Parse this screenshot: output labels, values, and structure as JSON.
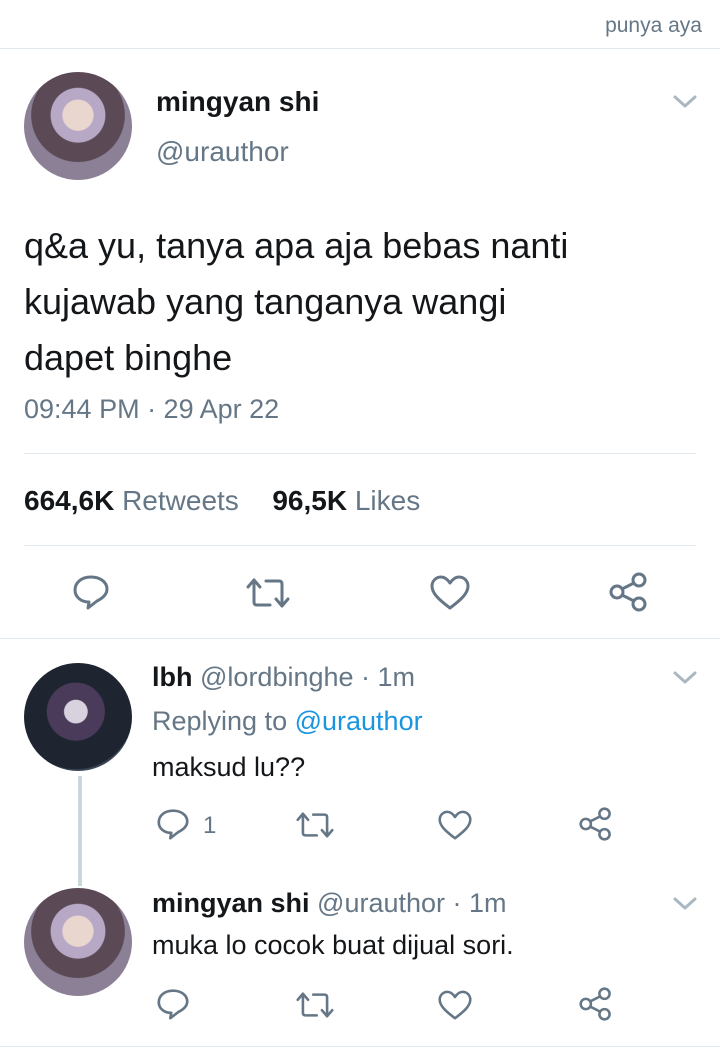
{
  "watermark": "punya aya",
  "main_tweet": {
    "display_name": "mingyan shi",
    "handle": "@urauthor",
    "text_lines": [
      "q&a yu, tanya apa aja bebas nanti",
      "kujawab yang tanganya wangi",
      "dapet binghe"
    ],
    "timestamp": "09:44 PM · 29 Apr 22",
    "retweets_count": "664,6K",
    "retweets_label": "Retweets",
    "likes_count": "96,5K",
    "likes_label": "Likes"
  },
  "reply1": {
    "display_name": "lbh",
    "handle": "@lordbinghe",
    "time": "· 1m",
    "replying_prefix": "Replying to",
    "replying_handle": "@urauthor",
    "text": "maksud lu??",
    "reply_count": "1"
  },
  "reply2": {
    "display_name": "mingyan shi",
    "handle": "@urauthor",
    "time": "· 1m",
    "text": "muka lo cocok buat dijual sori."
  },
  "colors": {
    "text": "#14171a",
    "muted": "#657786",
    "link": "#1b95e0",
    "divider": "#e1e8ed"
  }
}
